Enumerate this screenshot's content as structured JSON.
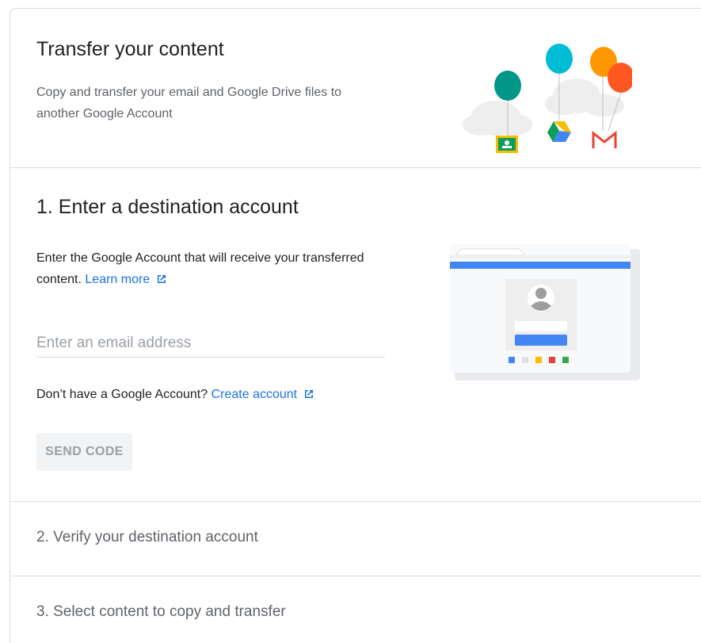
{
  "header": {
    "title": "Transfer your content",
    "description": "Copy and transfer your email and Google Drive files to another Google Account"
  },
  "step1": {
    "title": "1. Enter a destination account",
    "description": "Enter the Google Account that will receive your transferred content.",
    "learn_more": "Learn more",
    "email_placeholder": "Enter an email address",
    "no_account_text": "Don’t have a Google Account?",
    "create_account": "Create account",
    "send_code_label": "SEND CODE"
  },
  "step2": {
    "title": "2. Verify your destination account"
  },
  "step3": {
    "title": "3. Select content to copy and transfer"
  },
  "colors": {
    "link": "#1a73e8",
    "balloon_teal": "#009688",
    "balloon_cyan": "#00bcd4",
    "balloon_orange": "#ff9800",
    "balloon_red": "#ff5722",
    "google_blue": "#4285f4",
    "google_red": "#ea4335",
    "google_yellow": "#fbbc04",
    "google_green": "#34a853"
  },
  "icons": {
    "external": "external-link-icon",
    "classroom": "google-classroom-icon",
    "drive": "google-drive-icon",
    "gmail": "gmail-icon",
    "avatar": "avatar-icon"
  }
}
